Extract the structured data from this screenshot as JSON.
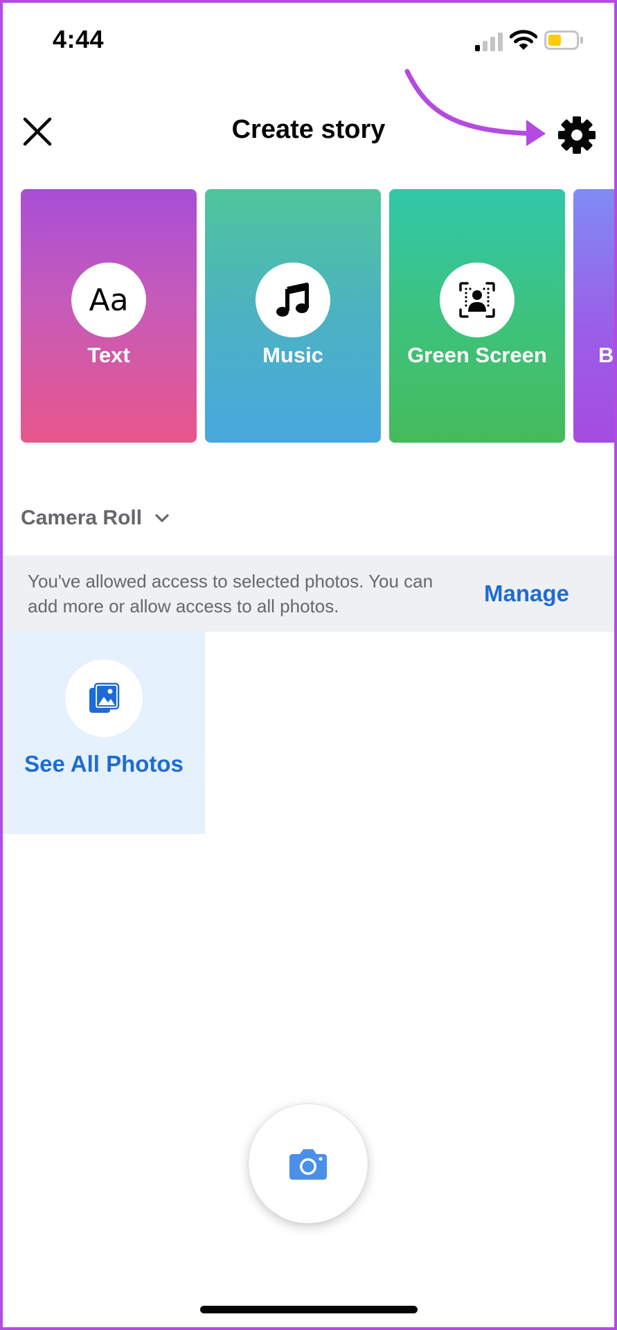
{
  "status_bar": {
    "time": "4:44"
  },
  "header": {
    "title": "Create story"
  },
  "story_types": [
    {
      "label": "Text",
      "icon": "text-aa-icon",
      "glyph": "Aa"
    },
    {
      "label": "Music",
      "icon": "music-note-icon"
    },
    {
      "label": "Green Screen",
      "icon": "green-screen-icon"
    },
    {
      "label": "B",
      "icon": "partial-card"
    }
  ],
  "camera_roll": {
    "label": "Camera Roll"
  },
  "access_banner": {
    "message": "You've allowed access to selected photos. You can add more or allow access to all photos.",
    "action_label": "Manage"
  },
  "see_all_photos": {
    "label": "See All Photos"
  },
  "colors": {
    "accent_blue": "#1e6bd6",
    "annotation_purple": "#b44be1",
    "secondary_text": "#65676b",
    "banner_bg": "#eef0f3",
    "tile_bg": "#e5f1fd",
    "battery_yellow": "#ffcc00"
  }
}
